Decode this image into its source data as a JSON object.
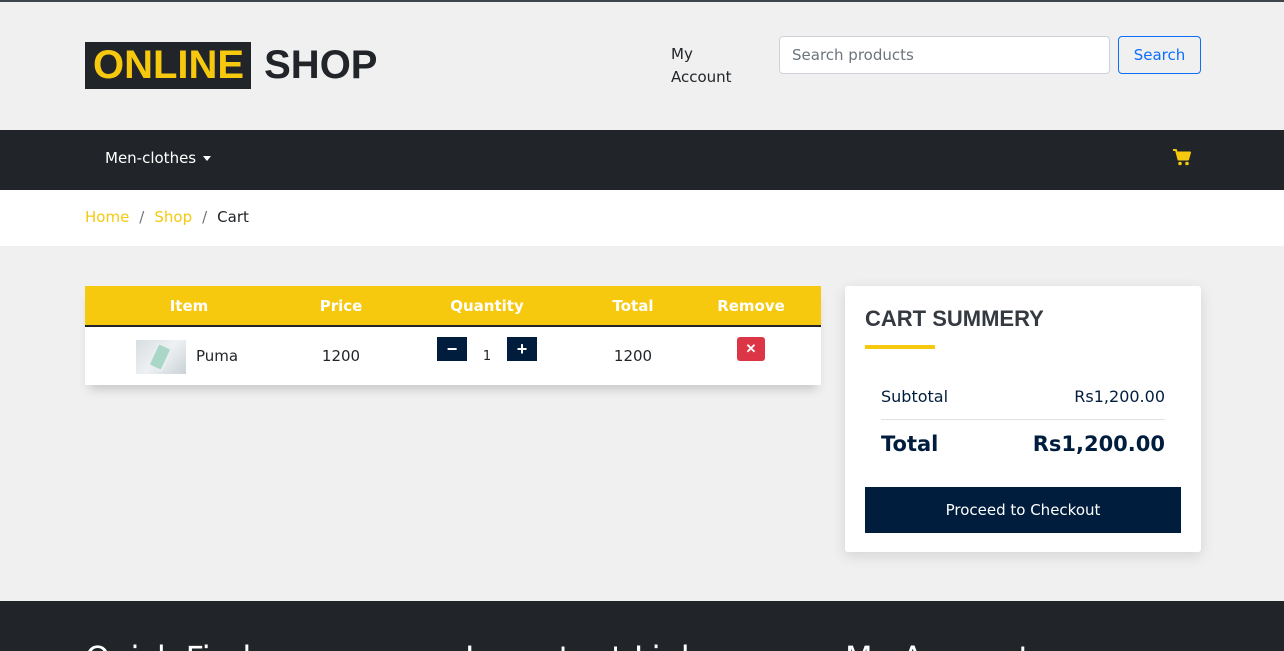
{
  "header": {
    "logo_highlight": "ONLINE",
    "logo_rest": "SHOP",
    "my_account": "My Account",
    "search_placeholder": "Search products",
    "search_button": "Search"
  },
  "nav": {
    "menu_item": "Men-clothes",
    "cart_icon": "shopping-cart-icon"
  },
  "breadcrumb": {
    "home": "Home",
    "shop": "Shop",
    "current": "Cart",
    "separator": "/"
  },
  "cart_table": {
    "headers": [
      "Item",
      "Price",
      "Quantity",
      "Total",
      "Remove"
    ],
    "rows": [
      {
        "name": "Puma",
        "price": "1200",
        "quantity": "1",
        "total": "1200",
        "minus": "−",
        "plus": "+",
        "remove": "✕"
      }
    ]
  },
  "summary": {
    "title": "CART SUMMERY",
    "subtotal_label": "Subtotal",
    "subtotal_value": "Rs1,200.00",
    "total_label": "Total",
    "total_value": "Rs1,200.00",
    "checkout_button": "Proceed to Checkout"
  },
  "footer": {
    "headings": [
      "Quick Find",
      "Important Links",
      "My Account"
    ]
  },
  "colors": {
    "accent": "#f6c90e",
    "dark": "#212529",
    "navy": "#001d3d",
    "danger": "#dc3545",
    "primary": "#0d6efd"
  }
}
